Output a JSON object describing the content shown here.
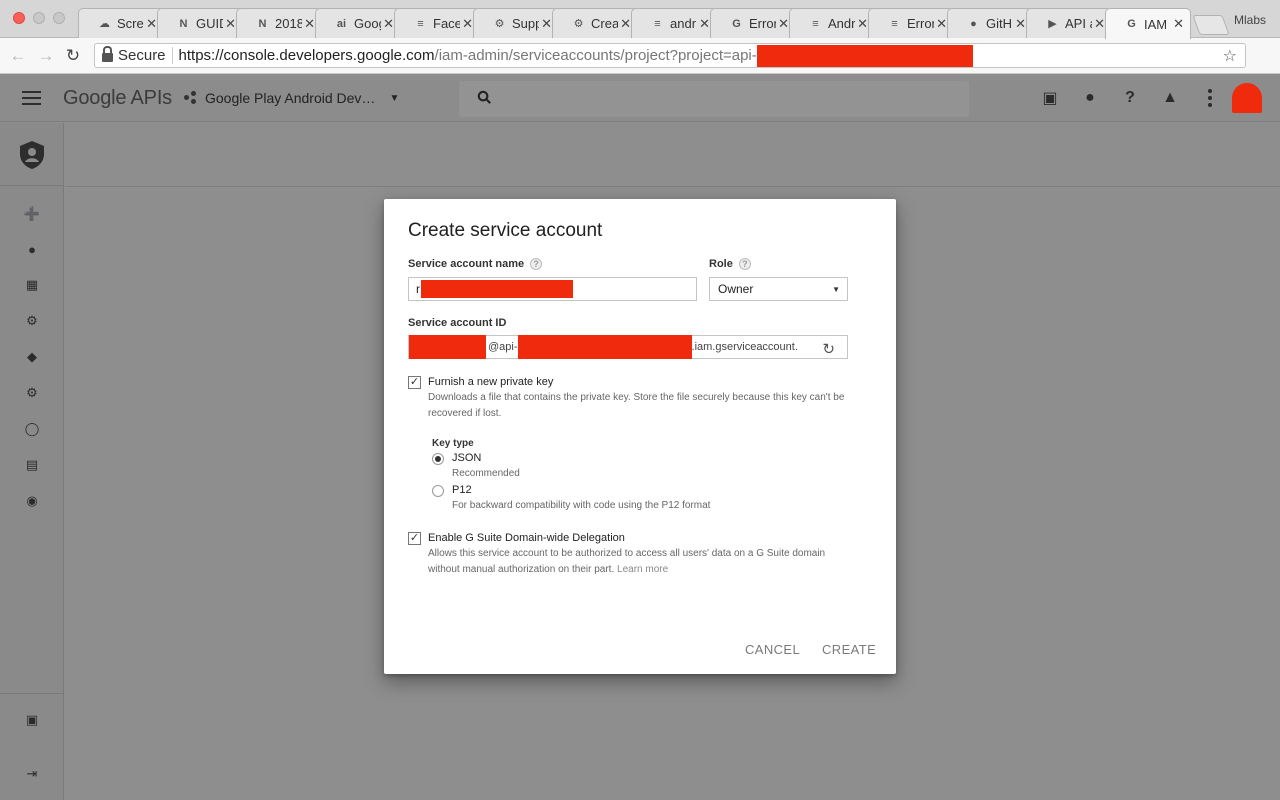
{
  "browser": {
    "tabs": [
      {
        "title": "Scre",
        "icon": "cloud-icon"
      },
      {
        "title": "GUID",
        "icon": "notion-icon"
      },
      {
        "title": "2018",
        "icon": "notion-icon"
      },
      {
        "title": "Goog",
        "icon": "ai-icon"
      },
      {
        "title": "Face",
        "icon": "stack-icon"
      },
      {
        "title": "Supp",
        "icon": "android-icon"
      },
      {
        "title": "Crea",
        "icon": "android-icon"
      },
      {
        "title": "andr",
        "icon": "stack-icon"
      },
      {
        "title": "Error",
        "icon": "google-icon"
      },
      {
        "title": "Andr",
        "icon": "stack-icon"
      },
      {
        "title": "Error",
        "icon": "stack-icon"
      },
      {
        "title": "GitH",
        "icon": "github-icon"
      },
      {
        "title": "API a",
        "icon": "play-icon"
      },
      {
        "title": "IAM",
        "icon": "google-icon",
        "active": true
      }
    ],
    "profile_name": "Mlabs",
    "address": {
      "secure_label": "Secure",
      "url_host": "https://console.developers.google.com",
      "url_path": "/iam-admin/serviceaccounts/project?project=api-"
    }
  },
  "app": {
    "logo": "Google APIs",
    "project_name": "Google Play Android Dev…"
  },
  "dialog": {
    "title": "Create service account",
    "name_label": "Service account name",
    "name_value": "r",
    "role_label": "Role",
    "role_value": "Owner",
    "id_label": "Service account ID",
    "id_prefix": "@api-",
    "id_suffix": ".iam.gserviceaccount.",
    "private_key": {
      "label": "Furnish a new private key",
      "checked": true,
      "description": "Downloads a file that contains the private key. Store the file securely because this key can't be recovered if lost."
    },
    "key_type": {
      "label": "Key type",
      "options": [
        {
          "label": "JSON",
          "hint": "Recommended",
          "selected": true
        },
        {
          "label": "P12",
          "hint": "For backward compatibility with code using the P12 format",
          "selected": false
        }
      ]
    },
    "delegation": {
      "label": "Enable G Suite Domain-wide Delegation",
      "checked": true,
      "description": "Allows this service account to be authorized to access all users' data on a G Suite domain without manual authorization on their part.",
      "link": "Learn more"
    },
    "cancel_label": "CANCEL",
    "create_label": "CREATE"
  },
  "colors": {
    "redaction": "#f02a0c",
    "overlay": "#8e8e8e"
  }
}
